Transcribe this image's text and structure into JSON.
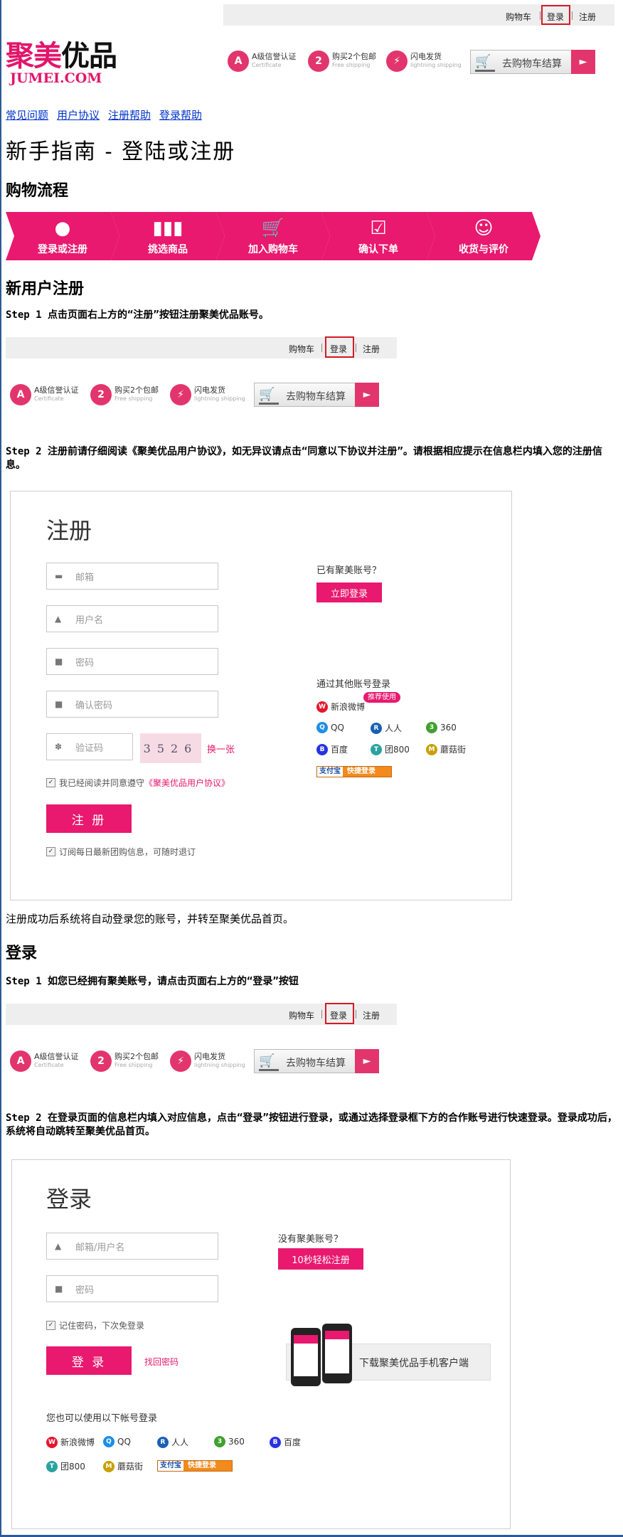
{
  "header": {
    "links": {
      "cart": "购物车",
      "login": "登录",
      "register": "注册"
    },
    "logo": {
      "cn": "聚美优品",
      "en": "JUMEI.COM"
    },
    "badges": [
      {
        "icon": "A",
        "title": "A级信誉认证",
        "sub": "Certificate"
      },
      {
        "icon": "2",
        "title": "购买2个包邮",
        "sub": "Free shipping"
      },
      {
        "icon": "⚡",
        "title": "闪电发货",
        "sub": "lightning shipping"
      }
    ],
    "cart_button": "去购物车结算"
  },
  "nav": [
    "常见问题",
    "用户协议",
    "注册帮助",
    "登录帮助"
  ],
  "page_title": "新手指南 - 登陆或注册",
  "flow_title": "购物流程",
  "flow": [
    {
      "icon": "●",
      "label": "登录或注册"
    },
    {
      "icon": "▮▮▮",
      "label": "挑选商品"
    },
    {
      "icon": "🛒",
      "label": "加入购物车"
    },
    {
      "icon": "☑",
      "label": "确认下单"
    },
    {
      "icon": "☺",
      "label": "收货与评价"
    }
  ],
  "register_section": {
    "title": "新用户注册",
    "step1": "Step 1 点击页面右上方的“注册”按钮注册聚美优品账号。",
    "step2": "Step 2 注册前请仔细阅读《聚美优品用户协议》，如无异议请点击“同意以下协议并注册”。请根据相应提示在信息栏内填入您的注册信息。",
    "after": "注册成功后系统将自动登录您的账号，并转至聚美优品首页。"
  },
  "register_form": {
    "title": "注册",
    "fields": [
      {
        "icon": "▬",
        "placeholder": "邮箱"
      },
      {
        "icon": "▲",
        "placeholder": "用户名"
      },
      {
        "icon": "■",
        "placeholder": "密码"
      },
      {
        "icon": "■",
        "placeholder": "确认密码"
      }
    ],
    "captcha": {
      "icon": "✽",
      "placeholder": "验证码",
      "code": "3526",
      "refresh": "换一张"
    },
    "agree_prefix": "我已经阅读并同意遵守",
    "agree_link": "《聚美优品用户协议》",
    "submit": "注 册",
    "subscribe": "订阅每日最新团购信息，可随时退订",
    "have_account": "已有聚美账号？",
    "login_now": "立即登录",
    "other_login": "通过其他账号登录",
    "recommend": "推荐使用",
    "socials": [
      {
        "name": "新浪微博",
        "color": "#e6162d",
        "glyph": "W"
      },
      {
        "name": "QQ",
        "color": "#1e8ee8",
        "glyph": "Q"
      },
      {
        "name": "人人",
        "color": "#1a5fb4",
        "glyph": "R"
      },
      {
        "name": "360",
        "color": "#41a02f",
        "glyph": "3"
      },
      {
        "name": "百度",
        "color": "#2932e1",
        "glyph": "B"
      },
      {
        "name": "团800",
        "color": "#2aa3a0",
        "glyph": "T"
      },
      {
        "name": "蘑菇街",
        "color": "#c8a000",
        "glyph": "M"
      }
    ],
    "alipay": {
      "brand": "支付宝",
      "label": "快捷登录"
    }
  },
  "login_section": {
    "title": "登录",
    "step1": "Step 1 如您已经拥有聚美账号，请点击页面右上方的“登录”按钮",
    "step2": "Step 2 在登录页面的信息栏内填入对应信息，点击“登录”按钮进行登录，或通过选择登录框下方的合作账号进行快速登录。登录成功后，系统将自动跳转至聚美优品首页。"
  },
  "login_form": {
    "title": "登录",
    "fields": [
      {
        "icon": "▲",
        "placeholder": "邮箱/用户名"
      },
      {
        "icon": "■",
        "placeholder": "密码"
      }
    ],
    "remember": "记住密码，下次免登录",
    "submit": "登 录",
    "forgot": "找回密码",
    "no_account": "没有聚美账号？",
    "quick_register": "10秒轻松注册",
    "download": "下载聚美优品手机客户端",
    "other_login": "您也可以使用以下帐号登录"
  }
}
